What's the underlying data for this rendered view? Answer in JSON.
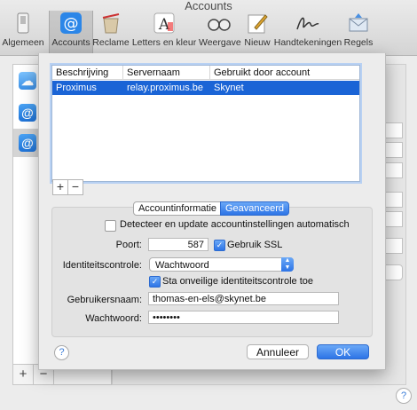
{
  "window": {
    "title": "Accounts"
  },
  "toolbar": {
    "items": [
      {
        "label": "Algemeen",
        "icon": "switch-icon"
      },
      {
        "label": "Accounts",
        "icon": "at-icon"
      },
      {
        "label": "Reclame",
        "icon": "trash-junk-icon"
      },
      {
        "label": "Letters en kleur",
        "icon": "fonts-colors-icon"
      },
      {
        "label": "Weergave",
        "icon": "glasses-icon"
      },
      {
        "label": "Nieuw",
        "icon": "compose-icon"
      },
      {
        "label": "Handtekeningen",
        "icon": "signature-icon"
      },
      {
        "label": "Regels",
        "icon": "rules-icon"
      }
    ]
  },
  "table": {
    "headers": [
      "Beschrijving",
      "Servernaam",
      "Gebruikt door account"
    ],
    "rows": [
      {
        "description": "Proximus",
        "server": "relay.proximus.be",
        "used_by": "Skynet"
      }
    ]
  },
  "list_controls": {
    "add": "+",
    "remove": "−"
  },
  "tabs": [
    {
      "label": "Accountinformatie",
      "selected": false
    },
    {
      "label": "Geavanceerd",
      "selected": true
    }
  ],
  "settings": {
    "auto_detect_label": "Detecteer en update accountinstellingen automatisch",
    "auto_detect_checked": false,
    "port_label": "Poort:",
    "port_value": "587",
    "ssl_label": "Gebruik SSL",
    "ssl_checked": true,
    "identity_label": "Identiteitscontrole:",
    "identity_value": "Wachtwoord",
    "insecure_label": "Sta onveilige identiteitscontrole toe",
    "insecure_checked": true,
    "username_label": "Gebruikersnaam:",
    "username_value": "thomas-en-els@skynet.be",
    "password_label": "Wachtwoord:",
    "password_value": "••••••••"
  },
  "buttons": {
    "help": "?",
    "cancel": "Annuleer",
    "ok": "OK"
  },
  "colors": {
    "accent": "#2d74e6",
    "selection": "#1a64d6"
  }
}
